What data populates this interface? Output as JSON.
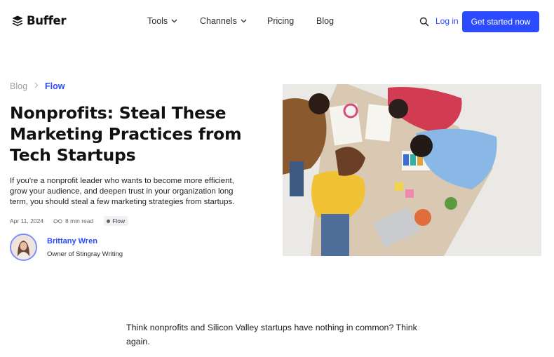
{
  "brand": {
    "name": "Buffer"
  },
  "nav": {
    "items": [
      {
        "label": "Tools",
        "dropdown": true
      },
      {
        "label": "Channels",
        "dropdown": true
      },
      {
        "label": "Pricing",
        "dropdown": false
      },
      {
        "label": "Blog",
        "dropdown": false
      }
    ],
    "login_label": "Log in",
    "cta_label": "Get started now"
  },
  "breadcrumb": {
    "root": "Blog",
    "current": "Flow"
  },
  "article": {
    "title": "Nonprofits: Steal These Marketing Practices from Tech Startups",
    "lede": "If you're a nonprofit leader who wants to become more efficient, grow your audience, and deepen trust in your organization long term, you should steal a few marketing strategies from startups.",
    "date": "Apr 11, 2024",
    "read_time": "8 min read",
    "tag": "Flow",
    "author": {
      "name": "Brittany Wren",
      "role": "Owner of Stingray Writing"
    },
    "body_first_paragraph": "Think nonprofits and Silicon Valley startups have nothing in common? Think again."
  },
  "colors": {
    "accent": "#2c4bff",
    "text": "#111111",
    "muted": "#9aa0a6"
  },
  "icons": {
    "logo": "buffer-stack-icon",
    "chevron": "chevron-down-icon",
    "search": "search-icon",
    "read": "glasses-icon"
  }
}
